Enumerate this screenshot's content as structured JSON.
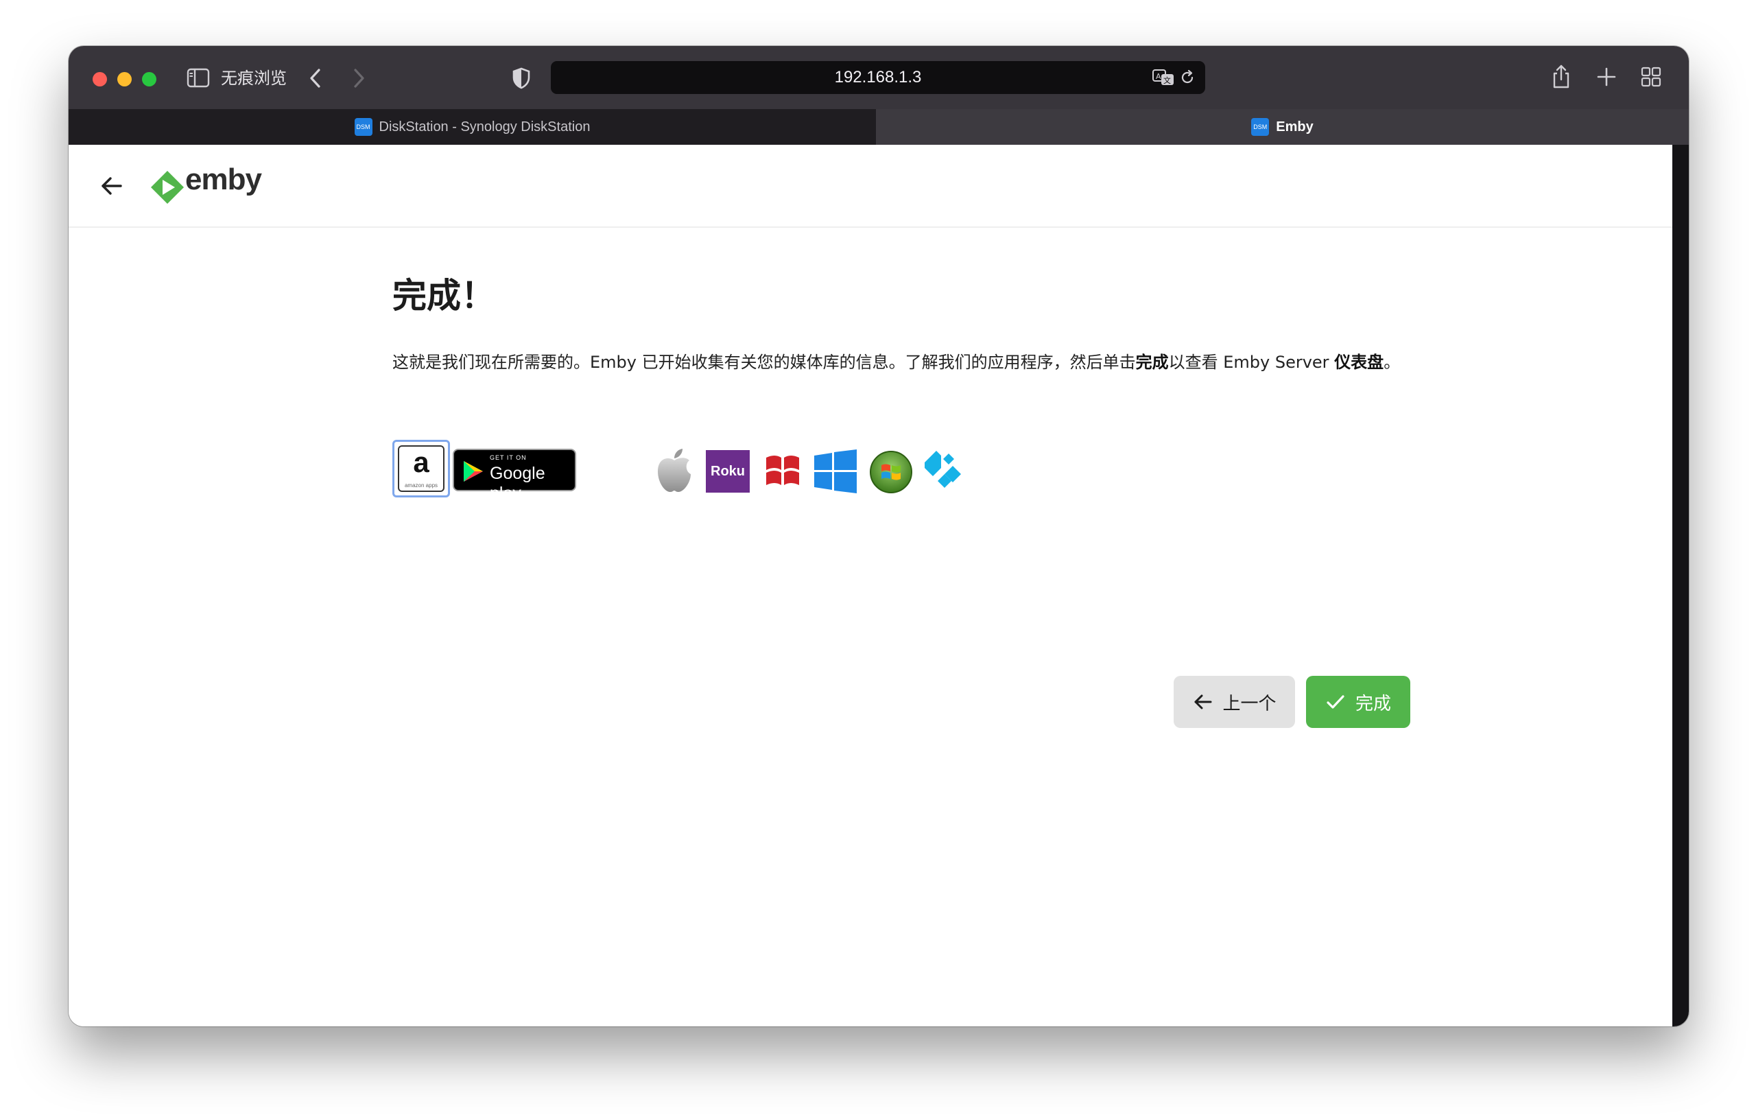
{
  "browser": {
    "private_label": "无痕浏览",
    "address": "192.168.1.3",
    "tabs": [
      {
        "title": "DiskStation - Synology DiskStation",
        "favicon": "DSM",
        "active": false
      },
      {
        "title": "Emby",
        "favicon": "DSM",
        "active": true
      }
    ]
  },
  "app": {
    "brand": "emby",
    "brand_color": "#52b54b"
  },
  "wizard": {
    "title": "完成！",
    "text_part1": "这就是我们现在所需要的。Emby 已开始收集有关您的媒体库的信息。了解我们的应用程序，然后单击",
    "text_bold1": "完成",
    "text_part2": "以查看 Emby Server ",
    "text_bold2": "仪表盘",
    "text_part3": "。",
    "apps": [
      {
        "name": "amazon-icon",
        "label": "a",
        "sublabel": "amazon apps"
      },
      {
        "name": "google-play-icon",
        "small": "GET IT ON",
        "big": "Google play"
      },
      {
        "name": "apple-icon"
      },
      {
        "name": "roku-icon",
        "label": "Roku"
      },
      {
        "name": "windows-8-icon"
      },
      {
        "name": "windows-10-icon"
      },
      {
        "name": "windows-7-icon"
      },
      {
        "name": "kodi-icon"
      }
    ],
    "prev_label": "上一个",
    "finish_label": "完成"
  }
}
